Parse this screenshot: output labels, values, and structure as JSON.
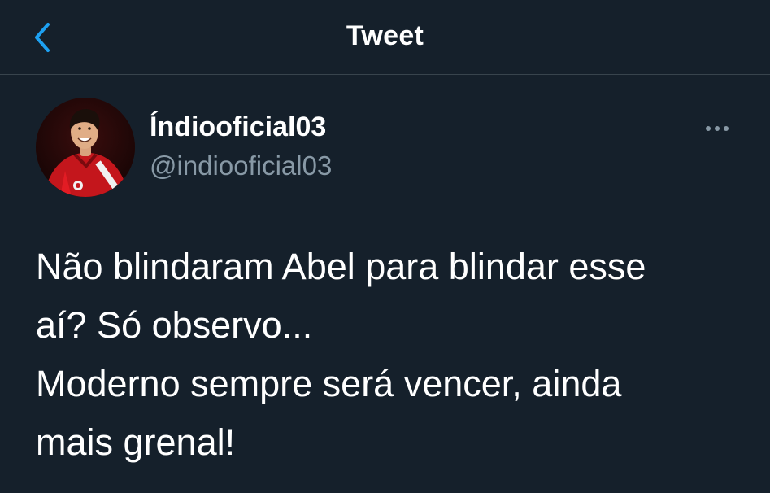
{
  "header": {
    "title": "Tweet",
    "back_icon": "chevron-left-icon",
    "accent_color": "#1da1f2"
  },
  "author": {
    "display_name": "Índiooficial03",
    "handle": "@indiooficial03",
    "avatar_icon": "profile-photo"
  },
  "more_icon": "more-horizontal-icon",
  "tweet": {
    "lines": [
      "Não blindaram Abel para blindar esse",
      "aí? Só observo...",
      "Moderno sempre será vencer, ainda",
      "mais grenal!"
    ]
  },
  "colors": {
    "background": "#15202b",
    "divider": "#38444d",
    "secondary_text": "#8899a6",
    "primary_text": "#ffffff"
  }
}
